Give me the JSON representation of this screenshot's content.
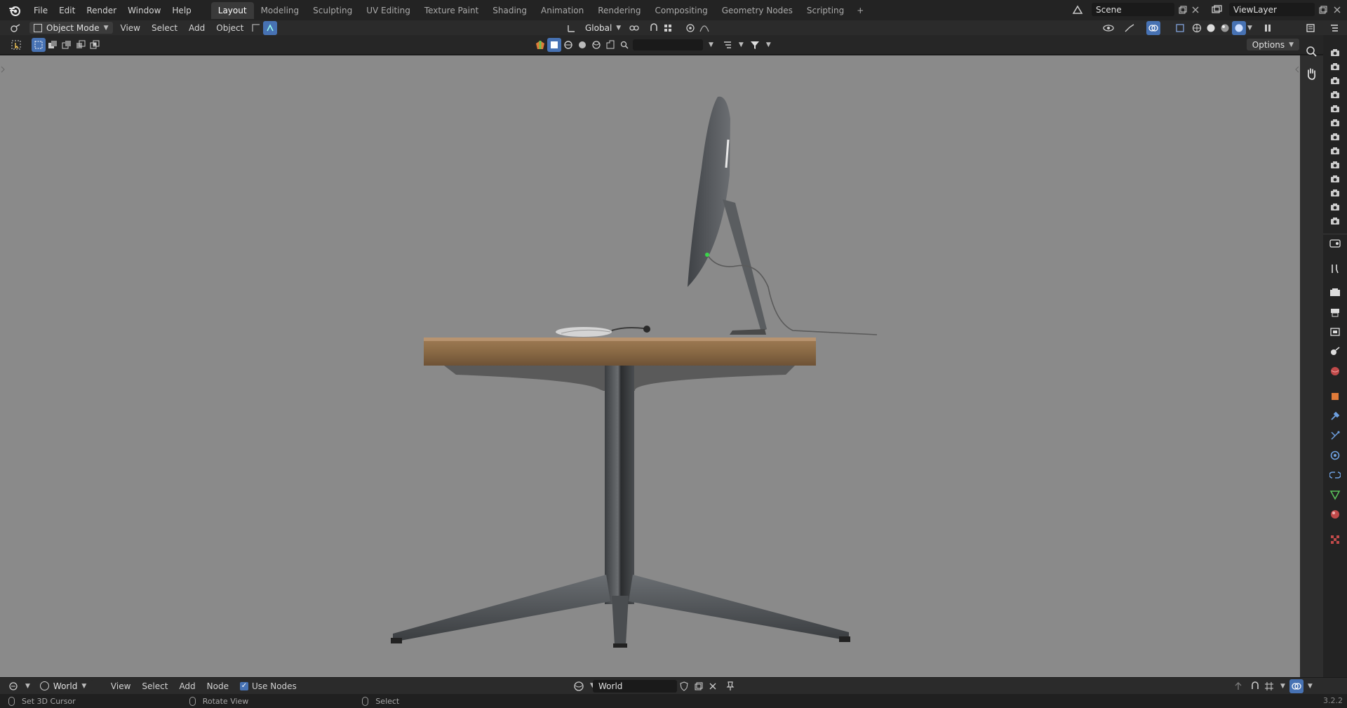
{
  "topbar": {
    "menus": [
      "File",
      "Edit",
      "Render",
      "Window",
      "Help"
    ],
    "workspaces": [
      "Layout",
      "Modeling",
      "Sculpting",
      "UV Editing",
      "Texture Paint",
      "Shading",
      "Animation",
      "Rendering",
      "Compositing",
      "Geometry Nodes",
      "Scripting"
    ],
    "active_workspace": "Layout",
    "scene_name": "Scene",
    "view_layer_name": "ViewLayer"
  },
  "header": {
    "mode": "Object Mode",
    "menus": [
      "View",
      "Select",
      "Add",
      "Object"
    ],
    "transform_orientation": "Global"
  },
  "toolrow": {
    "options_label": "Options",
    "search_placeholder": ""
  },
  "viewport": {
    "background_color": "#8a8a8a",
    "objects": [
      "desk",
      "monitor",
      "mouse",
      "cable"
    ]
  },
  "nodebar": {
    "editor_type": "World",
    "menus": [
      "View",
      "Select",
      "Add",
      "Node"
    ],
    "use_nodes_label": "Use Nodes",
    "use_nodes_checked": true,
    "world_name": "World"
  },
  "statusbar": {
    "items": [
      "Set 3D Cursor",
      "Rotate View",
      "Select"
    ],
    "version": "3.2.2"
  },
  "colors": {
    "accent": "#4772b3",
    "viewport_bg": "#8a8a8a",
    "wood": "#8a6a45"
  }
}
